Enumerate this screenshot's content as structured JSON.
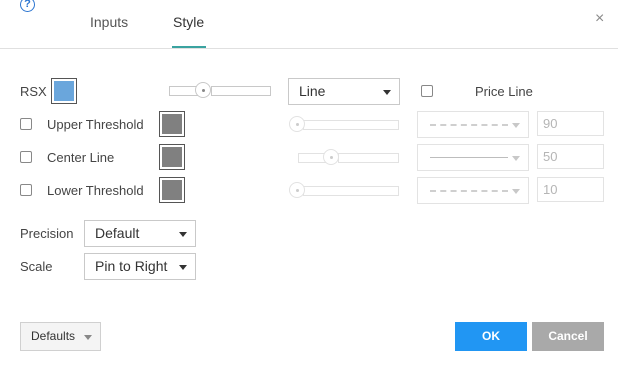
{
  "header": {
    "help_icon": "question-circle-icon",
    "help_glyph": "?",
    "close_icon": "close-icon",
    "close_glyph": "×",
    "tabs": [
      {
        "label": "Inputs",
        "active": false
      },
      {
        "label": "Style",
        "active": true
      }
    ],
    "accent_color": "#3aa3a0"
  },
  "rows": {
    "rsx": {
      "label": "RSX",
      "color": "#6aa6dc",
      "plot_type": "Line",
      "price_line_label": "Price Line",
      "price_line_checked": false
    },
    "upper": {
      "label": "Upper Threshold",
      "checked": false,
      "color": "#808080",
      "line_style": "dashed",
      "value": "90"
    },
    "center": {
      "label": "Center Line",
      "checked": false,
      "color": "#808080",
      "line_style": "solid",
      "value": "50"
    },
    "lower": {
      "label": "Lower Threshold",
      "checked": false,
      "color": "#808080",
      "line_style": "dashed",
      "value": "10"
    }
  },
  "settings": {
    "precision_label": "Precision",
    "precision_value": "Default",
    "scale_label": "Scale",
    "scale_value": "Pin to Right"
  },
  "footer": {
    "defaults_label": "Defaults",
    "ok_label": "OK",
    "cancel_label": "Cancel",
    "ok_color": "#2196f3",
    "cancel_color": "#a9a9a9"
  }
}
